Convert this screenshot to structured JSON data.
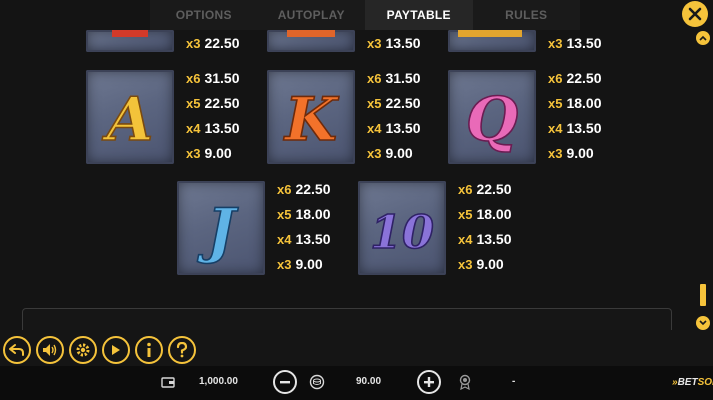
{
  "tabs": [
    {
      "label": "OPTIONS",
      "active": false
    },
    {
      "label": "AUTOPLAY",
      "active": false
    },
    {
      "label": "PAYTABLE",
      "active": true
    },
    {
      "label": "RULES",
      "active": false
    }
  ],
  "top_partial_payouts": [
    {
      "mult": "x3",
      "amount": "22.50"
    },
    {
      "mult": "x3",
      "amount": "13.50"
    },
    {
      "mult": "x3",
      "amount": "13.50"
    }
  ],
  "symbols": [
    {
      "name": "A",
      "letter": "A",
      "color": "#f3c33a",
      "payouts": [
        {
          "mult": "x6",
          "amount": "31.50"
        },
        {
          "mult": "x5",
          "amount": "22.50"
        },
        {
          "mult": "x4",
          "amount": "13.50"
        },
        {
          "mult": "x3",
          "amount": "9.00"
        }
      ]
    },
    {
      "name": "K",
      "letter": "K",
      "color": "#f2722a",
      "payouts": [
        {
          "mult": "x6",
          "amount": "31.50"
        },
        {
          "mult": "x5",
          "amount": "22.50"
        },
        {
          "mult": "x4",
          "amount": "13.50"
        },
        {
          "mult": "x3",
          "amount": "9.00"
        }
      ]
    },
    {
      "name": "Q",
      "letter": "Q",
      "color": "#e96ab8",
      "payouts": [
        {
          "mult": "x6",
          "amount": "22.50"
        },
        {
          "mult": "x5",
          "amount": "18.00"
        },
        {
          "mult": "x4",
          "amount": "13.50"
        },
        {
          "mult": "x3",
          "amount": "9.00"
        }
      ]
    },
    {
      "name": "J",
      "letter": "J",
      "color": "#5fb3e6",
      "payouts": [
        {
          "mult": "x6",
          "amount": "22.50"
        },
        {
          "mult": "x5",
          "amount": "18.00"
        },
        {
          "mult": "x4",
          "amount": "13.50"
        },
        {
          "mult": "x3",
          "amount": "9.00"
        }
      ]
    },
    {
      "name": "10",
      "letter": "10",
      "color": "#8a73d9",
      "payouts": [
        {
          "mult": "x6",
          "amount": "22.50"
        },
        {
          "mult": "x5",
          "amount": "18.00"
        },
        {
          "mult": "x4",
          "amount": "13.50"
        },
        {
          "mult": "x3",
          "amount": "9.00"
        }
      ]
    }
  ],
  "toolbar_icons": [
    "back-icon",
    "sound-icon",
    "settings-icon",
    "autoplay-icon",
    "info-icon",
    "help-icon"
  ],
  "bottom_bar": {
    "balance": "1,000.00",
    "bet": "90.00",
    "win": "-",
    "logo_prefix": "»",
    "logo_a": "BET",
    "logo_b": "SOFT"
  },
  "colors": {
    "accent": "#f5c33b",
    "background": "#141414",
    "tile": "#5b6580"
  }
}
